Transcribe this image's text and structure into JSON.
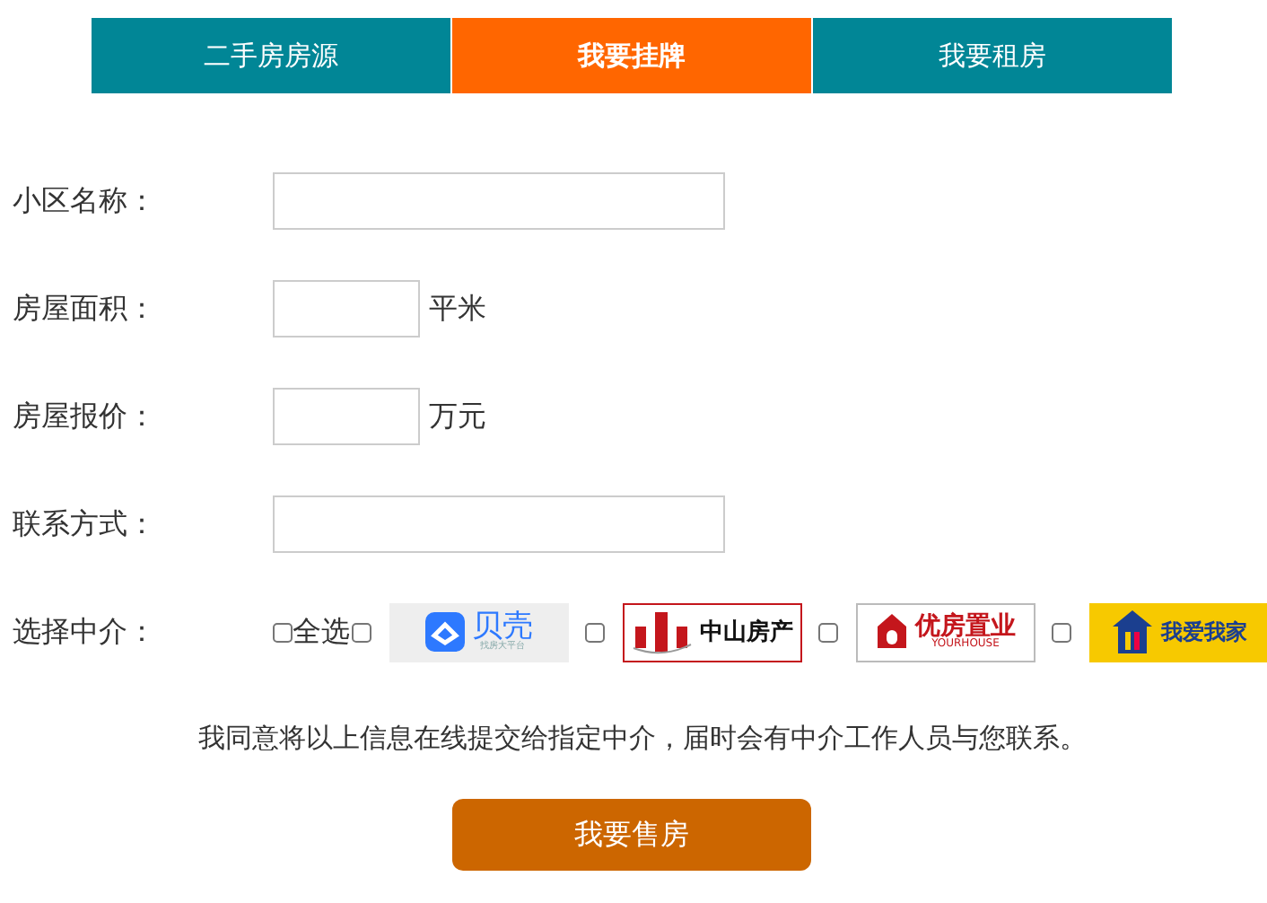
{
  "tabs": [
    {
      "label": "二手房房源",
      "selected": false
    },
    {
      "label": "我要挂牌",
      "selected": true
    },
    {
      "label": "我要租房",
      "selected": false
    }
  ],
  "form": {
    "fields": [
      {
        "label": "小区名称：",
        "kind": "wide"
      },
      {
        "label": "房屋面积：",
        "kind": "short",
        "unit": "平米"
      },
      {
        "label": "房屋报价：",
        "kind": "short",
        "unit": "万元"
      },
      {
        "label": "联系方式：",
        "kind": "wide"
      }
    ],
    "agents": {
      "label": "选择中介：",
      "select_all": {
        "label": "全选",
        "checked": false
      },
      "items": [
        {
          "kind": "beike",
          "checked": false,
          "name": "贝壳",
          "tagline": "找房大平台"
        },
        {
          "kind": "zhongshan",
          "checked": false,
          "name": "中山房产"
        },
        {
          "kind": "youfang",
          "checked": false,
          "name": "优房置业",
          "tagline": "YOURHOUSE"
        },
        {
          "kind": "woaiwojia",
          "checked": false,
          "name": "我爱我家"
        }
      ]
    }
  },
  "agreement": "我同意将以上信息在线提交给指定中介，届时会有中介工作人员与您联系。",
  "submit": "我要售房"
}
